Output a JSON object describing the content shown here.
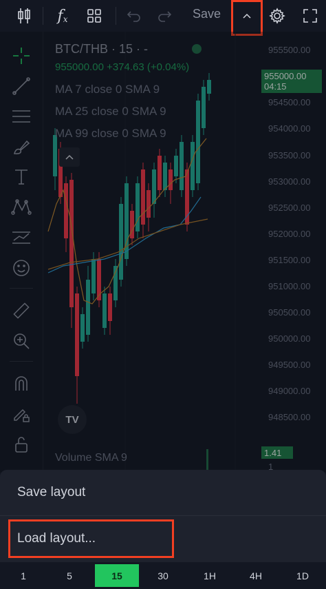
{
  "toolbar": {
    "fx_label": "f",
    "fx_sub": "x",
    "save_label": "Save"
  },
  "chart": {
    "title": "BTC/THB · 15 · -",
    "last_price": "955000.00",
    "change": "+374.63 (+0.04%)",
    "ma_lines": [
      "MA 7 close 0 SMA 9",
      "MA 25 close 0 SMA 9",
      "MA 99 close 0 SMA 9"
    ],
    "price_axis": [
      "955500.00",
      "954500.00",
      "954000.00",
      "953500.00",
      "953000.00",
      "952500.00",
      "952000.00",
      "951500.00",
      "951000.00",
      "950500.00",
      "950000.00",
      "949500.00",
      "949000.00",
      "948500.00"
    ],
    "price_tag_value": "955000.00",
    "price_tag_time": "04:15",
    "volume_label": "Volume SMA 9",
    "volume_tag": "1.41",
    "volume_axis_value": "1",
    "logo_text": "TV",
    "colors": {
      "up": "#22ab94",
      "down": "#f23645",
      "ma7": "#e0a14a",
      "ma25": "#2e9ed6",
      "ma99": "#c0862e",
      "highlight": "#f23f22"
    }
  },
  "sheet": {
    "save_layout": "Save layout",
    "load_layout": "Load layout..."
  },
  "timeframes": [
    {
      "label": "1",
      "active": false
    },
    {
      "label": "5",
      "active": false
    },
    {
      "label": "15",
      "active": true
    },
    {
      "label": "30",
      "active": false
    },
    {
      "label": "1H",
      "active": false
    },
    {
      "label": "4H",
      "active": false
    },
    {
      "label": "1D",
      "active": false
    }
  ]
}
